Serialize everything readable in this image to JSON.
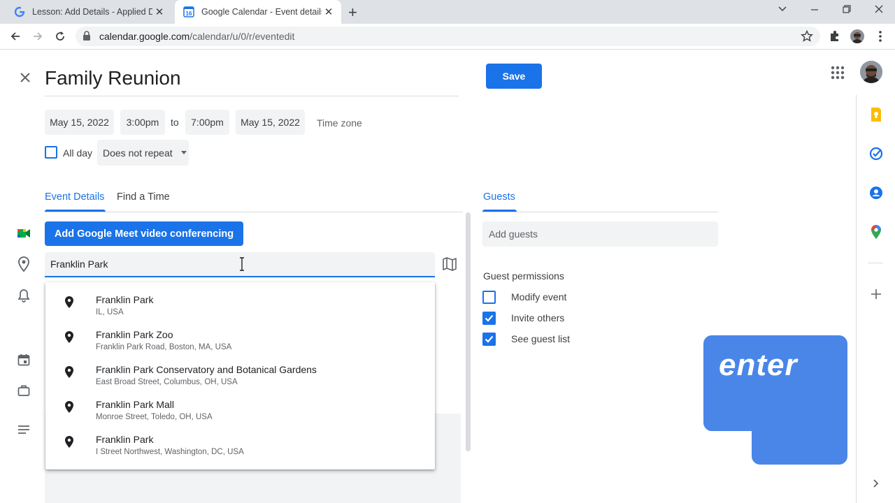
{
  "browser": {
    "tabs": [
      {
        "title": "Lesson: Add Details - Applied Dig",
        "favicon": "G",
        "active": false
      },
      {
        "title": "Google Calendar - Event details",
        "favicon": "16",
        "active": true
      }
    ],
    "url_host": "calendar.google.com",
    "url_path": "/calendar/u/0/r/eventedit"
  },
  "event": {
    "title": "Family Reunion",
    "save_label": "Save",
    "start_date": "May 15, 2022",
    "start_time": "3:00pm",
    "to_label": "to",
    "end_time": "7:00pm",
    "end_date": "May 15, 2022",
    "timezone_label": "Time zone",
    "allday_label": "All day",
    "repeat_label": "Does not repeat"
  },
  "details": {
    "tabs": [
      "Event Details",
      "Find a Time"
    ],
    "meet_button": "Add Google Meet video conferencing",
    "location_value": "Franklin Park"
  },
  "suggestions": [
    {
      "name": "Franklin Park",
      "address": "IL, USA"
    },
    {
      "name": "Franklin Park Zoo",
      "address": "Franklin Park Road, Boston, MA, USA"
    },
    {
      "name": "Franklin Park Conservatory and Botanical Gardens",
      "address": "East Broad Street, Columbus, OH, USA"
    },
    {
      "name": "Franklin Park Mall",
      "address": "Monroe Street, Toledo, OH, USA"
    },
    {
      "name": "Franklin Park",
      "address": "I Street Northwest, Washington, DC, USA"
    }
  ],
  "guests": {
    "tab_label": "Guests",
    "add_placeholder": "Add guests",
    "permissions_title": "Guest permissions",
    "permissions": [
      {
        "label": "Modify event",
        "checked": false
      },
      {
        "label": "Invite others",
        "checked": true
      },
      {
        "label": "See guest list",
        "checked": true
      }
    ]
  },
  "overlay": {
    "key_label": "enter"
  },
  "colors": {
    "accent": "#1a73e8",
    "key_overlay": "#4a86e8"
  }
}
